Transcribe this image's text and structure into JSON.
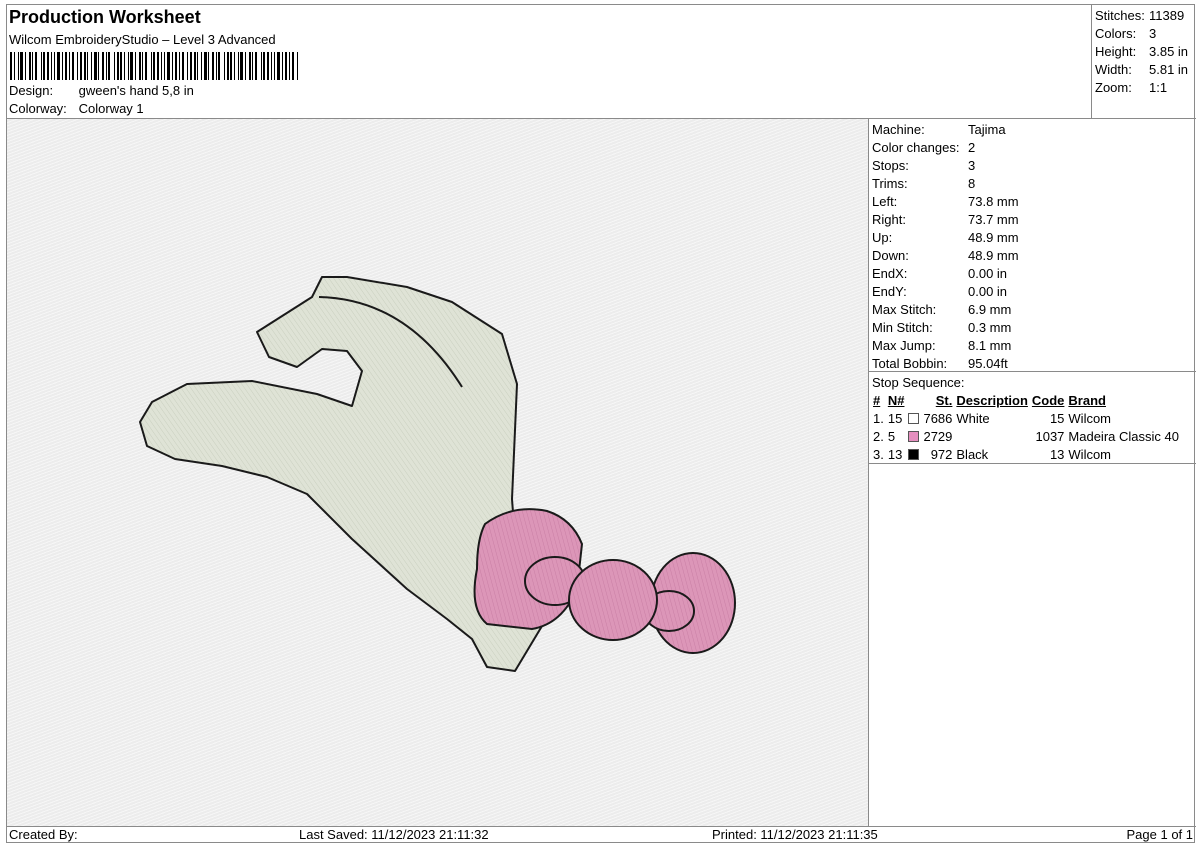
{
  "header": {
    "title": "Production Worksheet",
    "subtitle": "Wilcom EmbroideryStudio – Level 3 Advanced",
    "design_label": "Design:",
    "design_value": "gween's hand 5,8 in",
    "colorway_label": "Colorway:",
    "colorway_value": "Colorway 1"
  },
  "summary": [
    {
      "label": "Stitches:",
      "value": "11389"
    },
    {
      "label": "Colors:",
      "value": "3"
    },
    {
      "label": "Height:",
      "value": "3.85 in"
    },
    {
      "label": "Width:",
      "value": "5.81 in"
    },
    {
      "label": "Zoom:",
      "value": "1:1"
    }
  ],
  "machine_info": [
    {
      "label": "Machine:",
      "value": "Tajima"
    },
    {
      "label": "Color changes:",
      "value": "2"
    },
    {
      "label": "Stops:",
      "value": "3"
    },
    {
      "label": "Trims:",
      "value": "8"
    },
    {
      "label": "Left:",
      "value": "73.8 mm"
    },
    {
      "label": "Right:",
      "value": "73.7 mm"
    },
    {
      "label": "Up:",
      "value": "48.9 mm"
    },
    {
      "label": "Down:",
      "value": "48.9 mm"
    },
    {
      "label": "EndX:",
      "value": "0.00 in"
    },
    {
      "label": "EndY:",
      "value": "0.00 in"
    },
    {
      "label": "Max Stitch:",
      "value": "6.9 mm"
    },
    {
      "label": "Min Stitch:",
      "value": "0.3 mm"
    },
    {
      "label": "Max Jump:",
      "value": "8.1 mm"
    },
    {
      "label": "Total Bobbin:",
      "value": "95.04ft"
    }
  ],
  "stop_sequence": {
    "caption": "Stop Sequence:",
    "headers": {
      "hash": "#",
      "n": "N#",
      "st": "St.",
      "description": "Description",
      "code": "Code",
      "brand": "Brand"
    },
    "rows": [
      {
        "index": "1.",
        "n": "15",
        "color": "#ffffff",
        "st": "7686",
        "description": "White",
        "code": "15",
        "brand": "Wilcom"
      },
      {
        "index": "2.",
        "n": "5",
        "color": "#e58fbf",
        "st": "2729",
        "description": "",
        "code": "1037",
        "brand": "Madeira Classic 40"
      },
      {
        "index": "3.",
        "n": "13",
        "color": "#000000",
        "st": "972",
        "description": "Black",
        "code": "13",
        "brand": "Wilcom"
      }
    ]
  },
  "design_colors": {
    "glove": "#dfe3d6",
    "bow": "#dc96b8",
    "outline": "#1a1a1a"
  },
  "footer": {
    "created_by": "Created By:",
    "last_saved": "Last Saved: 11/12/2023 21:11:32",
    "printed": "Printed: 11/12/2023 21:11:35",
    "page": "Page 1 of 1"
  }
}
